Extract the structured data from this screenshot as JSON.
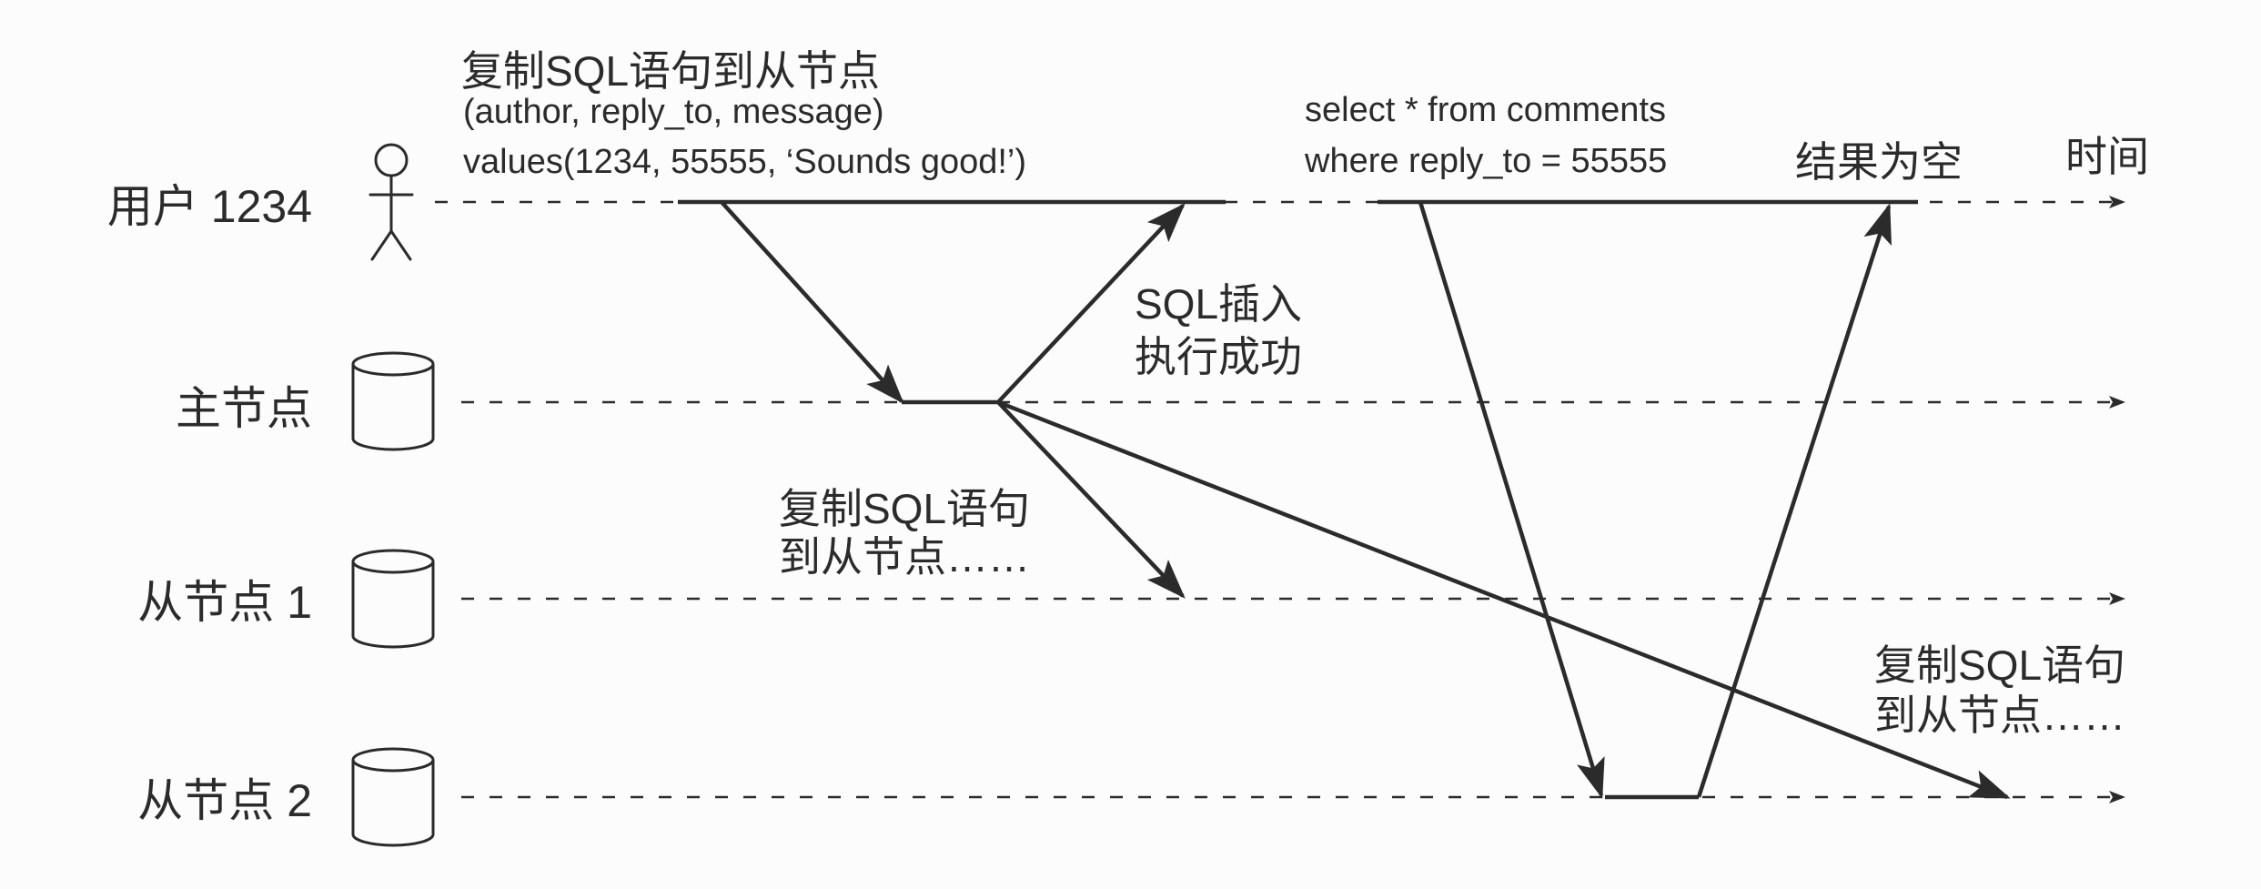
{
  "diagram": {
    "time_label": "时间",
    "lanes": [
      {
        "label": "用户 1234",
        "icon": "person-icon"
      },
      {
        "label": "主节点",
        "icon": "database-icon"
      },
      {
        "label": "从节点 1",
        "icon": "database-icon"
      },
      {
        "label": "从节点 2",
        "icon": "database-icon"
      }
    ],
    "insert_request": [
      "复制SQL语句到从节点",
      "(author, reply_to, message)",
      "values(1234, 55555, ‘Sounds good!’)"
    ],
    "insert_ack": [
      "SQL插入",
      "执行成功"
    ],
    "replication_to_follower_1": [
      "复制SQL语句",
      "到从节点……"
    ],
    "replication_to_follower_2": [
      "复制SQL语句",
      "到从节点……"
    ],
    "select_query": [
      "select * from comments",
      "where reply_to = 55555"
    ],
    "select_result": "结果为空"
  },
  "colors": {
    "ink": "#2b2b2b",
    "background": "#fcfcfc"
  }
}
